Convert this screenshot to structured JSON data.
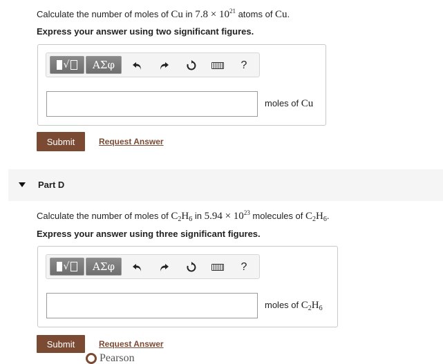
{
  "partC": {
    "q_prefix": "Calculate the number of moles of ",
    "q_substance": "Cu",
    "q_in": " in ",
    "q_mantissa": "7.8 × 10",
    "q_exp": "21",
    "q_suffix": " atoms of ",
    "q_substance2": "Cu",
    "q_end": ".",
    "instruction": "Express your answer using two significant figures.",
    "answer_value": "",
    "unit_prefix": "moles of ",
    "unit_substance": "Cu",
    "submit_label": "Submit",
    "request_label": "Request Answer"
  },
  "partD": {
    "title": "Part D",
    "q_prefix": "Calculate the number of moles of ",
    "q_sub_main": "C",
    "q_sub_2": "2",
    "q_sub_h": "H",
    "q_sub_6": "6",
    "q_in": " in ",
    "q_mantissa": "5.94 × 10",
    "q_exp": "23",
    "q_suffix": " molecules of ",
    "q2_main": "C",
    "q2_2": "2",
    "q2_h": "H",
    "q2_6": "6",
    "q_end": ".",
    "instruction": "Express your answer using three significant figures.",
    "answer_value": "",
    "unit_prefix": "moles of ",
    "u_main": "C",
    "u_2": "2",
    "u_h": "H",
    "u_6": "6",
    "submit_label": "Submit",
    "request_label": "Request Answer"
  },
  "toolbar": {
    "greek_label": "ΑΣφ",
    "help_label": "?",
    "icons": [
      "templates-icon",
      "greek-icon",
      "undo-icon",
      "redo-icon",
      "reset-icon",
      "keyboard-icon",
      "help-icon"
    ]
  },
  "footer": {
    "logo_text": "Pearson"
  },
  "colors": {
    "accent": "#7b4a33",
    "toolbar_button": "#7a7a7a",
    "part_bar": "#f5f5f5"
  }
}
